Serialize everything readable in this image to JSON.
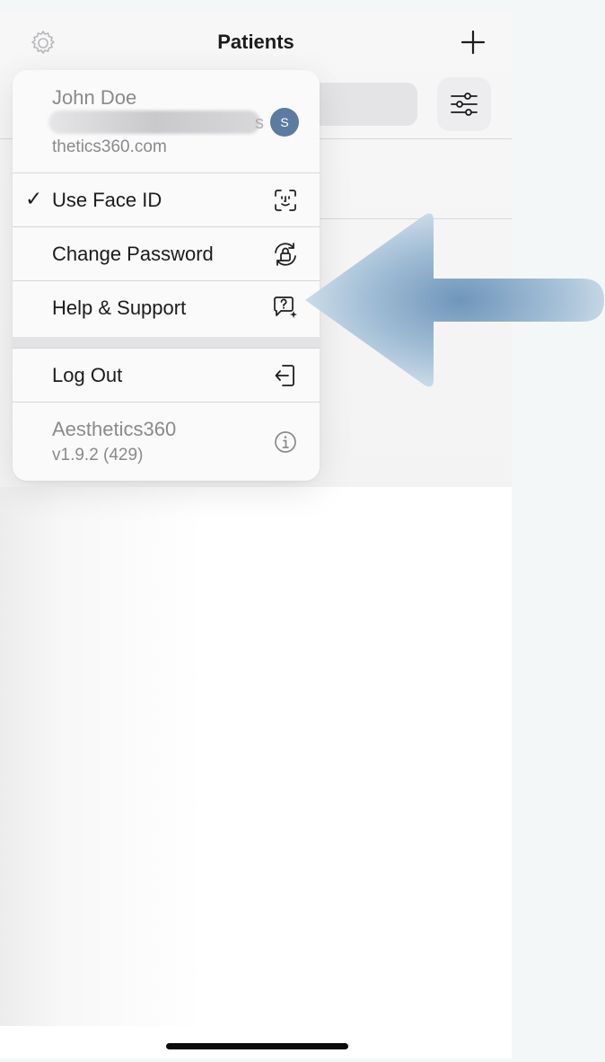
{
  "nav": {
    "title": "Patients"
  },
  "account": {
    "name": "John Doe",
    "email_partial_char": "s",
    "avatar_initial": "S",
    "avatar_color": "#5b7ba1",
    "domain_fragment": "thetics360.com"
  },
  "menu": {
    "items": [
      {
        "label": "Use Face ID",
        "checked": true,
        "check_mark": "✓",
        "icon": "face-id-icon"
      },
      {
        "label": "Change Password",
        "icon": "lock-rotation-icon"
      },
      {
        "label": "Help & Support",
        "icon": "help-bubble-sparkle-icon"
      },
      {
        "label": "Log Out",
        "icon": "log-out-icon"
      }
    ],
    "about": {
      "app_name": "Aesthetics360",
      "version": "v1.9.2 (429)",
      "icon": "info-icon"
    }
  },
  "annotation": {
    "arrow_color": "#6f96bb",
    "points_to": "Help & Support"
  }
}
